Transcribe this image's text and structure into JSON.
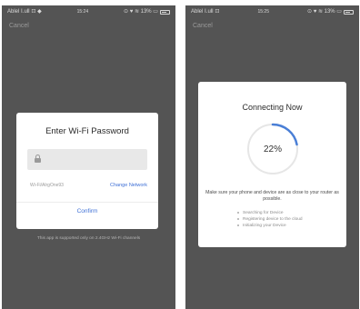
{
  "screens": [
    {
      "status_left": "Ablel Ⅰ.uⅡ ⊡ ◆",
      "status_time": "15:24",
      "status_right": "⊙ ♥ ≋ 13% ▭",
      "cancel_label": "Cancel",
      "dialog": {
        "title": "Enter Wi-Fi Password",
        "password_value": "",
        "ssid": "Wi-Fi/AlrgOne93",
        "change_network_label": "Change Network",
        "confirm_label": "Confirm"
      },
      "note": "This app is supported only on 2.4GHz Wi-Fi channels"
    },
    {
      "status_left": "Ablel Ⅰ.uⅡ ⊡",
      "status_time": "15:25",
      "status_right": "⊙ ♥ ≋ 13% ▭",
      "cancel_label": "Cancel",
      "dialog": {
        "title": "Connecting Now",
        "percent": 0.22,
        "percent_label": "22%",
        "instructions": "Make sure your phone and device are as close to your router as possible.",
        "steps": [
          "Searching for Device",
          "Registering device to the cloud",
          "Initializing your Device"
        ]
      }
    }
  ],
  "colors": {
    "overlay": "#545454",
    "accent": "#3d6fd6",
    "progress": "#4a7fd6",
    "ring_track": "#e6e6e6"
  },
  "icons": {
    "lock": "lock-icon",
    "battery": "battery-icon"
  }
}
